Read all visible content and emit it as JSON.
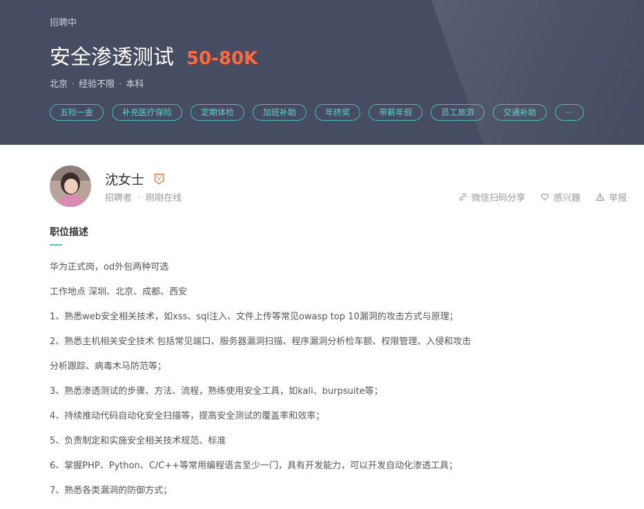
{
  "job": {
    "status": "招聘中",
    "title": "安全渗透测试",
    "salary": "50-80K",
    "meta": [
      "北京",
      "经验不限",
      "本科"
    ],
    "meta_separator": "·",
    "tags": [
      "五险一金",
      "补充医疗保险",
      "定期体检",
      "加班补助",
      "年终奖",
      "带薪年假",
      "员工旅游",
      "交通补助",
      "···"
    ]
  },
  "recruiter": {
    "name": "沈女士",
    "badge": "V",
    "role": "招聘者",
    "dot": "·",
    "online": "刚刚在线"
  },
  "actions": {
    "share": "微信扫码分享",
    "interest": "感兴趣",
    "report": "举报"
  },
  "description": {
    "title": "职位描述",
    "lines": [
      "华为正式岗，od外包两种可选",
      "工作地点 深圳、北京、成都、西安",
      "1、熟悉web安全相关技术，如xss、sql注入、文件上传等常见owasp top 10漏洞的攻击方式与原理；",
      "2、熟悉主机相关安全技术 包括常见端口、服务器漏洞扫描、程序漏洞分析检车额、权限管理、入侵和攻击",
      "分析跟踪、病毒木马防范等；",
      "3、熟悉渗透测试的步骤、方法、流程，熟练使用安全工具，如kali、burpsuite等；",
      "4、持续推动代码自动化安全扫描等，提高安全测试的覆盖率和效率；",
      "5、负责制定和实施安全相关技术规范、标准",
      "6、掌握PHP、Python、C/C++等常用编程语言至少一门，具有开发能力，可以开发自动化渗透工具；",
      "7、熟悉各类漏洞的防御方式；"
    ]
  },
  "icons": {
    "share": "link-icon",
    "interest": "heart-icon",
    "report": "warning-icon"
  },
  "colors": {
    "header_bg": "#464c61",
    "salary": "#ff6a3d",
    "accent": "#4ccbbf",
    "badge": "#e8773f"
  }
}
